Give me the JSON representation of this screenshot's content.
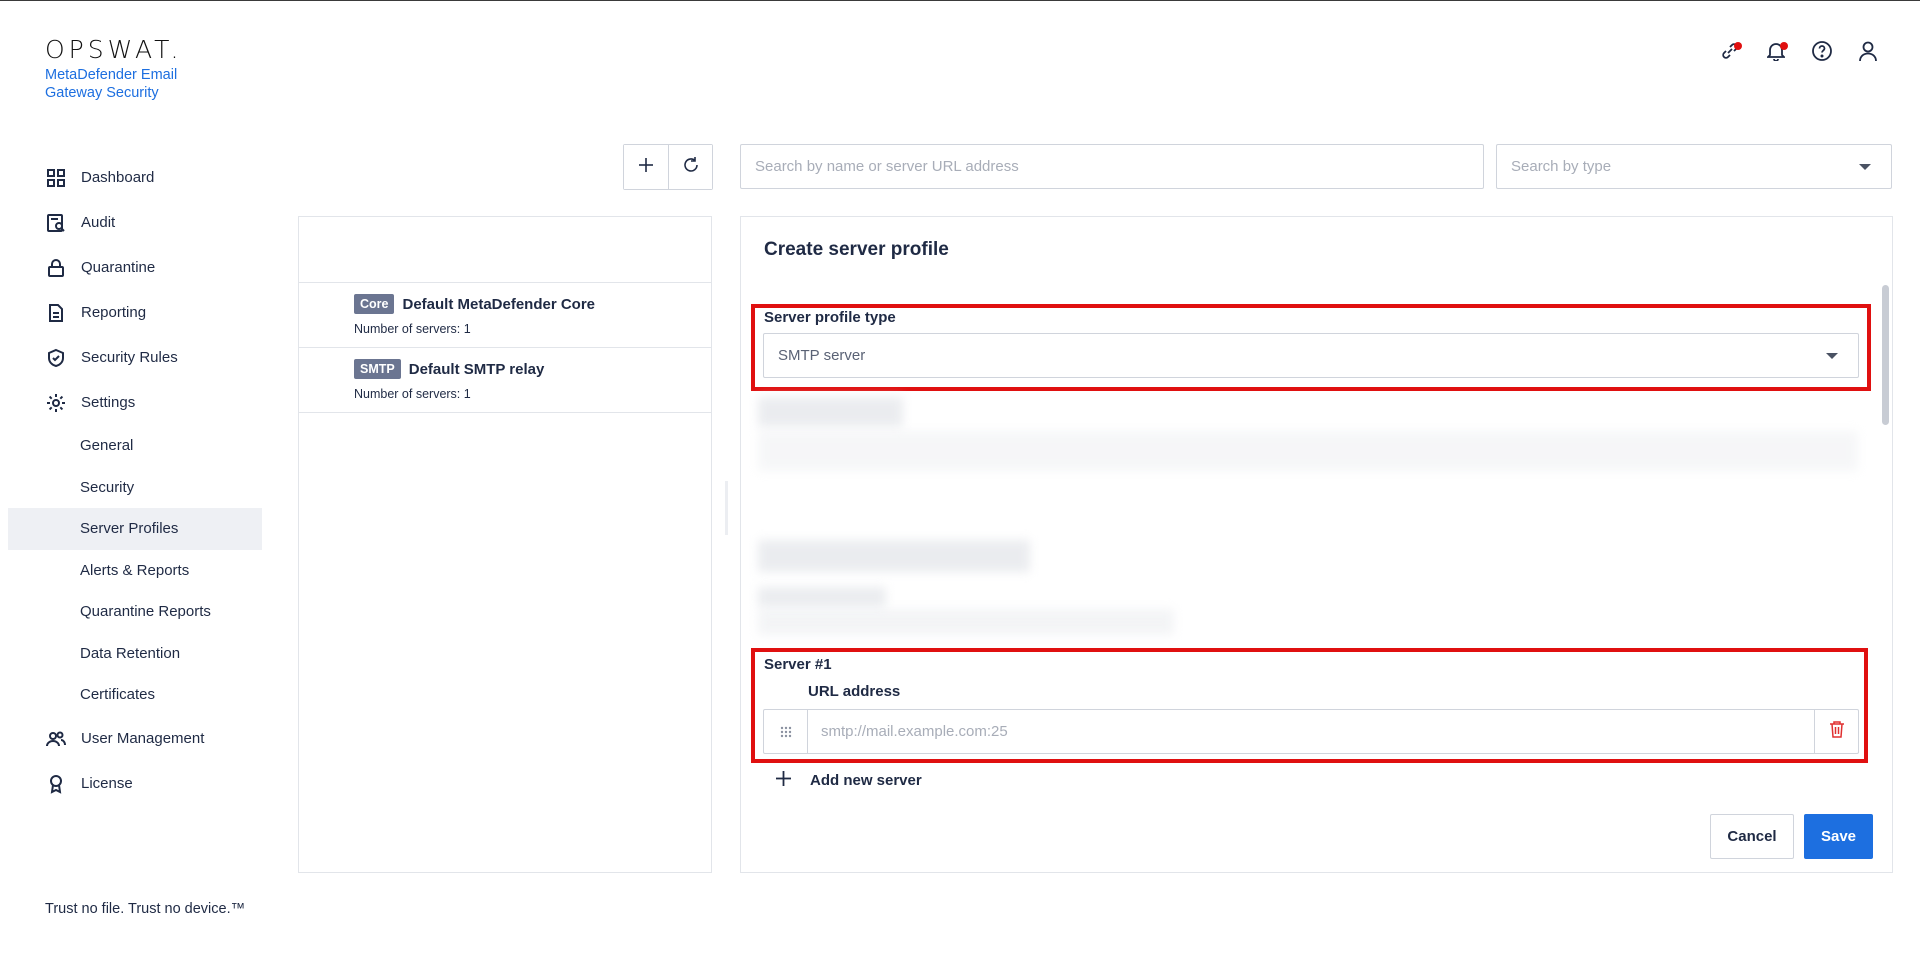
{
  "brand": {
    "logo_text": "OPSWAT.",
    "product_name": "MetaDefender Email Gateway Security",
    "tagline": "Trust no file. Trust no device.™",
    "accent_color": "#1d6fe0"
  },
  "header": {
    "icons": [
      {
        "name": "integrations-icon",
        "has_alert": true
      },
      {
        "name": "bell-icon",
        "has_alert": true
      },
      {
        "name": "help-icon",
        "has_alert": false
      },
      {
        "name": "user-icon",
        "has_alert": false
      }
    ]
  },
  "sidebar": {
    "items": [
      {
        "label": "Dashboard",
        "icon": "dashboard-icon"
      },
      {
        "label": "Audit",
        "icon": "audit-icon"
      },
      {
        "label": "Quarantine",
        "icon": "lock-icon"
      },
      {
        "label": "Reporting",
        "icon": "document-icon"
      },
      {
        "label": "Security Rules",
        "icon": "shield-check-icon"
      },
      {
        "label": "Settings",
        "icon": "gear-icon"
      }
    ],
    "settings_sub": [
      {
        "label": "General"
      },
      {
        "label": "Security"
      },
      {
        "label": "Server Profiles",
        "active": true
      },
      {
        "label": "Alerts & Reports"
      },
      {
        "label": "Quarantine Reports"
      },
      {
        "label": "Data Retention"
      },
      {
        "label": "Certificates"
      }
    ],
    "bottom_items": [
      {
        "label": "User Management",
        "icon": "users-icon"
      },
      {
        "label": "License",
        "icon": "badge-icon"
      }
    ]
  },
  "toolbar": {
    "add_icon": "plus-icon",
    "refresh_icon": "refresh-icon",
    "search_placeholder": "Search by name or server URL address",
    "type_placeholder": "Search by type"
  },
  "profiles": [
    {
      "badge": "Core",
      "name": "Default MetaDefender Core",
      "servers": "Number of servers: 1"
    },
    {
      "badge": "SMTP",
      "name": "Default SMTP relay",
      "servers": "Number of servers: 1"
    }
  ],
  "form": {
    "title": "Create server profile",
    "type_label": "Server profile type",
    "type_value": "SMTP server",
    "server_heading": "Server #1",
    "url_label": "URL address",
    "url_placeholder": "smtp://mail.example.com:25",
    "add_server_label": "Add new server",
    "cancel_label": "Cancel",
    "save_label": "Save",
    "highlight_color": "#e01010"
  }
}
